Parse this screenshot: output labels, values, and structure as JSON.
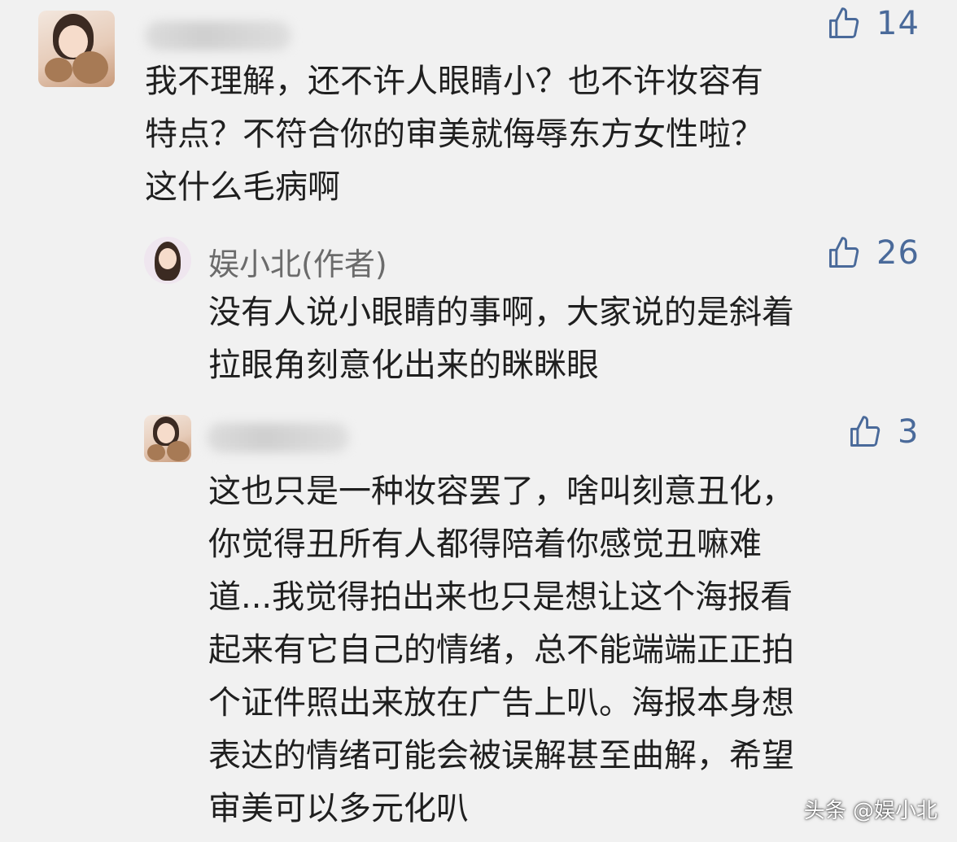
{
  "comments": [
    {
      "likes": "14",
      "text": "我不理解，还不许人眼睛小？也不许妆容有\n特点？不符合你的审美就侮辱东方女性啦？\n这什么毛病啊"
    },
    {
      "author": "娱小北(作者)",
      "likes": "26",
      "text": "没有人说小眼睛的事啊，大家说的是斜着\n拉眼角刻意化出来的眯眯眼"
    },
    {
      "likes": "3",
      "text": "这也只是一种妆容罢了，啥叫刻意丑化，\n你觉得丑所有人都得陪着你感觉丑嘛难\n道...我觉得拍出来也只是想让这个海报看\n起来有它自己的情绪，总不能端端正正拍\n个证件照出来放在广告上叭。海报本身想\n表达的情绪可能会被误解甚至曲解，希望\n审美可以多元化叭"
    }
  ],
  "watermark": "头条 @娱小北",
  "icons": {
    "like": "thumbs-up-icon"
  },
  "colors": {
    "background": "#f1f1f1",
    "like": "#4a6a9a",
    "author": "#6b6b6b"
  }
}
